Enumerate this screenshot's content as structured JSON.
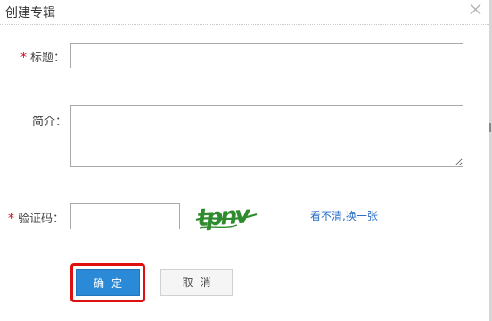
{
  "dialog": {
    "title": "创建专辑",
    "close_icon": "close-icon"
  },
  "form": {
    "required_mark": "*",
    "title_label": "标题：",
    "title_value": "",
    "intro_label": "简介：",
    "intro_value": "",
    "captcha_label": "验证码：",
    "captcha_value": "",
    "captcha_text": "tpnv",
    "refresh_link": "看不清,换一张"
  },
  "buttons": {
    "confirm_label": "确定",
    "cancel_label": "取消"
  },
  "colors": {
    "required": "#d0021b",
    "primary_button": "#2b8ad8",
    "link": "#2a6ec8",
    "highlight_border": "#e01010",
    "captcha_text": "#2e8b2e"
  }
}
